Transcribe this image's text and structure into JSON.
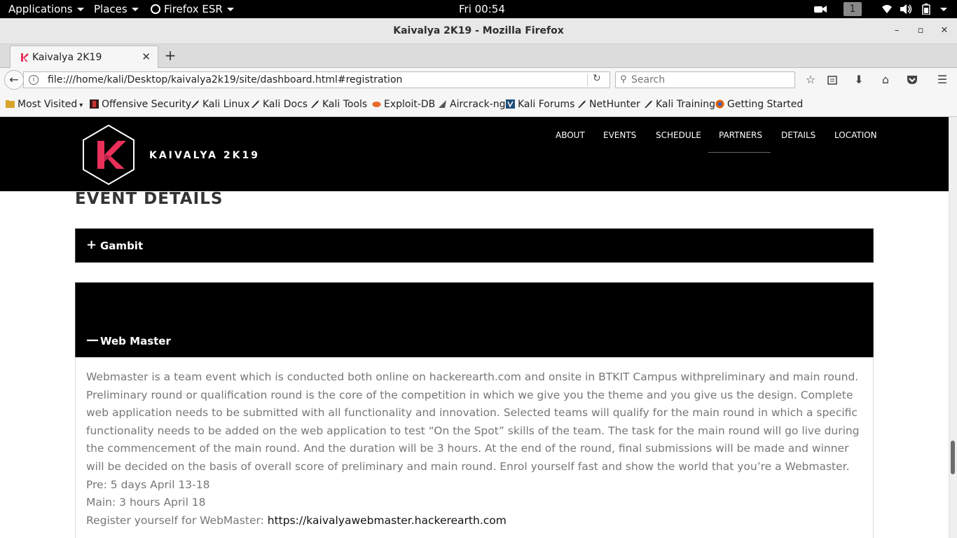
{
  "gnome": {
    "applications": "Applications",
    "places": "Places",
    "firefox_menu": "Firefox ESR",
    "clock": "Fri 00:54",
    "workspace": "1"
  },
  "window": {
    "title": "Kaivalya 2K19 - Mozilla Firefox",
    "minimize": "–",
    "maximize": "▫",
    "close": "✕"
  },
  "tab": {
    "label": "Kaivalya 2K19",
    "close": "✕",
    "new_tab": "+"
  },
  "nav": {
    "back": "←",
    "url": "file:///home/kali/Desktop/kaivalya2k19/site/dashboard.html#registration",
    "search_placeholder": "Search"
  },
  "bookmarks": [
    {
      "label": "Most Visited",
      "icon": "folder-icon"
    },
    {
      "label": "Offensive Security",
      "icon": "offsec-icon"
    },
    {
      "label": "Kali Linux",
      "icon": "kali-dragon-icon"
    },
    {
      "label": "Kali Docs",
      "icon": "kali-dragon-icon"
    },
    {
      "label": "Kali Tools",
      "icon": "kali-dragon-icon"
    },
    {
      "label": "Exploit-DB",
      "icon": "exploitdb-icon"
    },
    {
      "label": "Aircrack-ng",
      "icon": "aircrack-icon"
    },
    {
      "label": "Kali Forums",
      "icon": "kali-forums-icon"
    },
    {
      "label": "NetHunter",
      "icon": "kali-dragon-icon"
    },
    {
      "label": "Kali Training",
      "icon": "kali-dragon-icon"
    },
    {
      "label": "Getting Started",
      "icon": "firefox-icon"
    }
  ],
  "site": {
    "brand": "KAIVALYA 2K19",
    "nav": [
      "ABOUT",
      "EVENTS",
      "SCHEDULE",
      "PARTNERS",
      "DETAILS",
      "LOCATION"
    ],
    "active_nav": "PARTNERS",
    "section_title": "EVENT DETAILS",
    "accordion": [
      {
        "title": "Gambit",
        "sign": "+",
        "expanded": false
      },
      {
        "title": "Web Master",
        "sign": "—",
        "expanded": true
      }
    ],
    "webmaster": {
      "description": "Webmaster is a team event which is conducted both online on hackerearth.com and onsite in BTKIT Campus withpreliminary and main round. Preliminary round or qualification round is the core of the competition in which we give you the theme and you give us the design. Complete web application needs to be submitted with all functionality and innovation. Selected teams will qualify for the main round in which a specific functionality needs to be added on the web application to test “On the Spot” skills of the team. The task for the main round will go live during the commencement of the main round. And the duration will be 3 hours. At the end of the round, final submissions will be made and winner will be decided on the basis of overall score of preliminary and main round. Enrol yourself fast and show the world that you’re a Webmaster.",
      "pre": "Pre: 5 days April 13-18",
      "main": "Main: 3 hours April 18",
      "register_label": "Register yourself for WebMaster:",
      "register_link": "https://kaivalyawebmaster.hackerearth.com"
    }
  },
  "colors": {
    "site_header_bg": "#000000",
    "logo_accent": "#e8305a",
    "body_text": "#777777"
  }
}
